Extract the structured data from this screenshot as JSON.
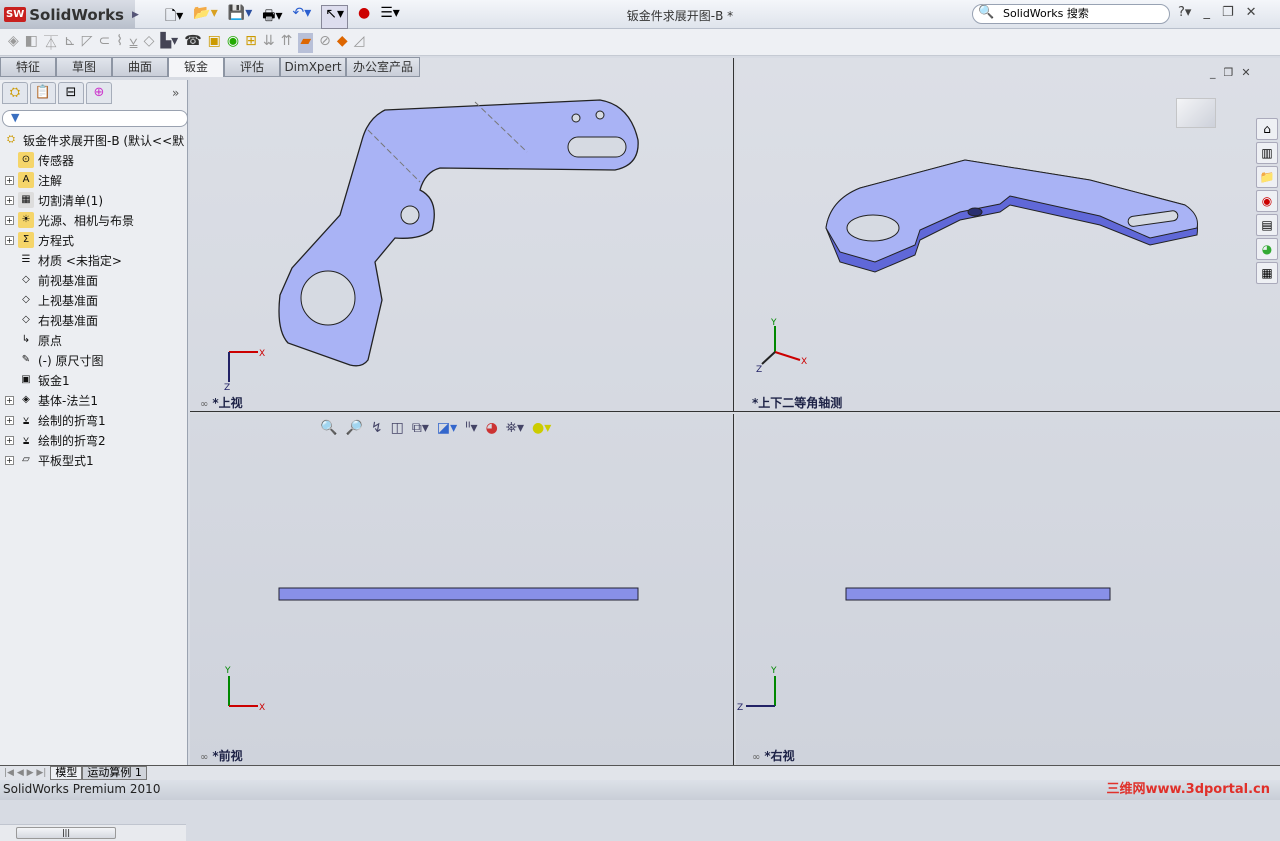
{
  "app": {
    "logo": "SolidWorks",
    "title": "钣金件求展开图-B *",
    "search_placeholder": "SolidWorks 搜索",
    "status": "SolidWorks Premium 2010",
    "watermark": "三维网www.3dportal.cn"
  },
  "tabs": [
    "特征",
    "草图",
    "曲面",
    "钣金",
    "评估",
    "DimXpert",
    "办公室产品"
  ],
  "active_tab": "钣金",
  "tree": {
    "root": "钣金件求展开图-B  (默认<<默",
    "items": [
      {
        "label": "传感器",
        "expandable": false,
        "icon": "sensor-icon"
      },
      {
        "label": "注解",
        "expandable": true,
        "icon": "annotation-icon"
      },
      {
        "label": "切割清单(1)",
        "expandable": true,
        "icon": "cut-list-icon"
      },
      {
        "label": "光源、相机与布景",
        "expandable": true,
        "icon": "lights-icon"
      },
      {
        "label": "方程式",
        "expandable": true,
        "icon": "equation-icon"
      },
      {
        "label": "材质 <未指定>",
        "expandable": false,
        "icon": "material-icon"
      },
      {
        "label": "前视基准面",
        "expandable": false,
        "icon": "plane-icon"
      },
      {
        "label": "上视基准面",
        "expandable": false,
        "icon": "plane-icon"
      },
      {
        "label": "右视基准面",
        "expandable": false,
        "icon": "plane-icon"
      },
      {
        "label": "原点",
        "expandable": false,
        "icon": "origin-icon"
      },
      {
        "label": "(-) 原尺寸图",
        "expandable": false,
        "icon": "sketch-icon"
      },
      {
        "label": "钣金1",
        "expandable": false,
        "icon": "sheet-metal-icon"
      },
      {
        "label": "基体-法兰1",
        "expandable": true,
        "icon": "base-flange-icon"
      },
      {
        "label": "绘制的折弯1",
        "expandable": true,
        "icon": "sketched-bend-icon"
      },
      {
        "label": "绘制的折弯2",
        "expandable": true,
        "icon": "sketched-bend-icon"
      },
      {
        "label": "平板型式1",
        "expandable": true,
        "icon": "flat-pattern-icon"
      }
    ]
  },
  "bottom_tabs": [
    "模型",
    "运动算例 1"
  ],
  "viewports": {
    "top": "*上视",
    "iso": "*上下二等角轴测",
    "front": "*前视",
    "right": "*右视"
  },
  "axes": {
    "x": "X",
    "y": "Y",
    "z": "Z"
  },
  "colors": {
    "part": "#a9b3f5",
    "edge": "#222",
    "viewport_bg": "#d6dae2"
  }
}
